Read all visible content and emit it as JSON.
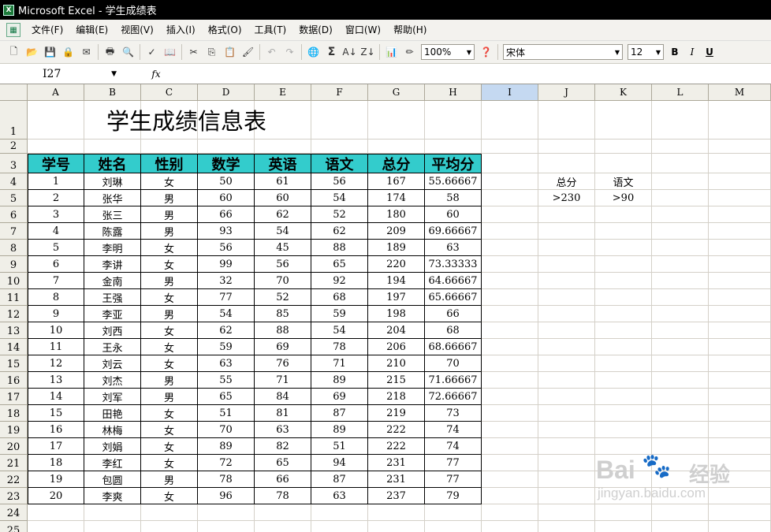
{
  "window": {
    "title": "Microsoft Excel - 学生成绩表",
    "app_icon": "X"
  },
  "menu": {
    "items": [
      "文件(F)",
      "编辑(E)",
      "视图(V)",
      "插入(I)",
      "格式(O)",
      "工具(T)",
      "数据(D)",
      "窗口(W)",
      "帮助(H)"
    ]
  },
  "toolbar": {
    "zoom": "100%",
    "font_name": "宋体",
    "font_size": "12",
    "bold_label": "B",
    "italic_label": "I",
    "underline_label": "U",
    "sigma": "Σ",
    "sort_asc": "A↓",
    "sort_desc": "Z↓"
  },
  "formula_bar": {
    "name_box": "I27",
    "fx_label": "fx",
    "content": ""
  },
  "columns": [
    "A",
    "B",
    "C",
    "D",
    "E",
    "F",
    "G",
    "H",
    "I",
    "J",
    "K",
    "L",
    "M"
  ],
  "selected_column": "I",
  "row_numbers": [
    "1",
    "2",
    "3",
    "4",
    "5",
    "6",
    "7",
    "8",
    "9",
    "10",
    "11",
    "12",
    "13",
    "14",
    "15",
    "16",
    "17",
    "18",
    "19",
    "20",
    "21",
    "22",
    "23",
    "24",
    "25"
  ],
  "sheet": {
    "title": "学生成绩信息表",
    "headers": [
      "学号",
      "姓名",
      "性别",
      "数学",
      "英语",
      "语文",
      "总分",
      "平均分"
    ],
    "rows": [
      [
        "1",
        "刘琳",
        "女",
        "50",
        "61",
        "56",
        "167",
        "55.66667"
      ],
      [
        "2",
        "张华",
        "男",
        "60",
        "60",
        "54",
        "174",
        "58"
      ],
      [
        "3",
        "张三",
        "男",
        "66",
        "62",
        "52",
        "180",
        "60"
      ],
      [
        "4",
        "陈露",
        "男",
        "93",
        "54",
        "62",
        "209",
        "69.66667"
      ],
      [
        "5",
        "李明",
        "女",
        "56",
        "45",
        "88",
        "189",
        "63"
      ],
      [
        "6",
        "李讲",
        "女",
        "99",
        "56",
        "65",
        "220",
        "73.33333"
      ],
      [
        "7",
        "金南",
        "男",
        "32",
        "70",
        "92",
        "194",
        "64.66667"
      ],
      [
        "8",
        "王强",
        "女",
        "77",
        "52",
        "68",
        "197",
        "65.66667"
      ],
      [
        "9",
        "李亚",
        "男",
        "54",
        "85",
        "59",
        "198",
        "66"
      ],
      [
        "10",
        "刘西",
        "女",
        "62",
        "88",
        "54",
        "204",
        "68"
      ],
      [
        "11",
        "王永",
        "女",
        "59",
        "69",
        "78",
        "206",
        "68.66667"
      ],
      [
        "12",
        "刘云",
        "女",
        "63",
        "76",
        "71",
        "210",
        "70"
      ],
      [
        "13",
        "刘杰",
        "男",
        "55",
        "71",
        "89",
        "215",
        "71.66667"
      ],
      [
        "14",
        "刘军",
        "男",
        "65",
        "84",
        "69",
        "218",
        "72.66667"
      ],
      [
        "15",
        "田艳",
        "女",
        "51",
        "81",
        "87",
        "219",
        "73"
      ],
      [
        "16",
        "林梅",
        "女",
        "70",
        "63",
        "89",
        "222",
        "74"
      ],
      [
        "17",
        "刘娟",
        "女",
        "89",
        "82",
        "51",
        "222",
        "74"
      ],
      [
        "18",
        "李红",
        "女",
        "72",
        "65",
        "94",
        "231",
        "77"
      ],
      [
        "19",
        "包圆",
        "男",
        "78",
        "66",
        "87",
        "231",
        "77"
      ],
      [
        "20",
        "李爽",
        "女",
        "96",
        "78",
        "63",
        "237",
        "79"
      ]
    ]
  },
  "criteria": {
    "headers": [
      "总分",
      "语文"
    ],
    "values": [
      ">230",
      ">90"
    ]
  },
  "watermark": {
    "brand": "Bai",
    "paw": "🐾",
    "jingyan": "经验",
    "url": "jingyan.baidu.com"
  }
}
